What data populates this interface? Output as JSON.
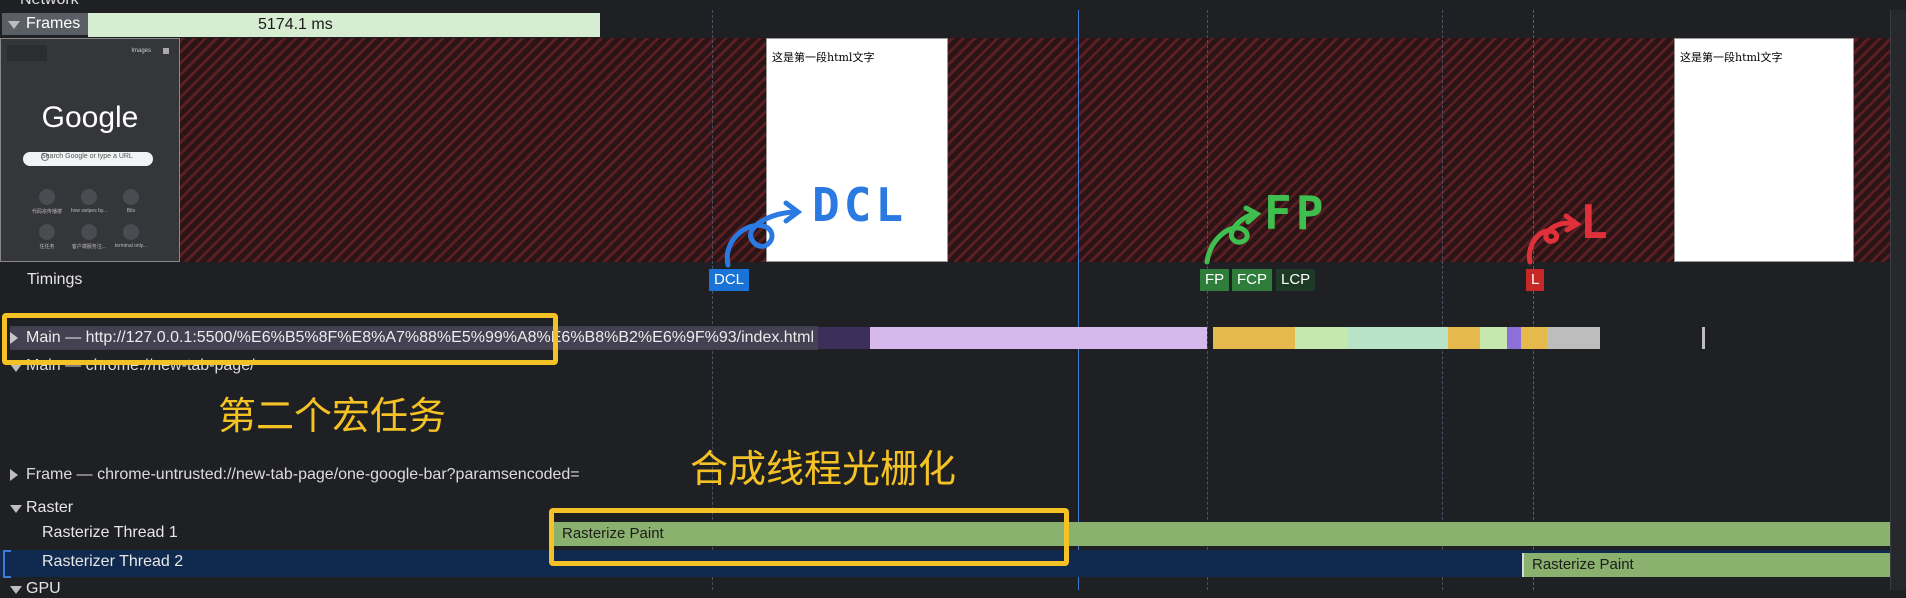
{
  "network": {
    "label": "Network"
  },
  "frames": {
    "label": "Frames",
    "duration": "5174.1 ms"
  },
  "thumbnails": {
    "google": {
      "logo": "Google",
      "search_placeholder": "Search Google or type a URL",
      "images_link": "Images",
      "shortcuts": [
        "代码宗传播楼",
        "how swipes by...",
        "Bits",
        "任任务",
        "客户端服务注...",
        "terminal only..."
      ]
    },
    "paint_text_1": "这是第一段html文字",
    "paint_text_2": "这是第一段html文字"
  },
  "timings": {
    "label": "Timings",
    "markers": {
      "dcl": "DCL",
      "fp": "FP",
      "fcp": "FCP",
      "lcp": "LCP",
      "l": "L"
    }
  },
  "tracks": {
    "main": "Main — http://127.0.0.1:5500/%E6%B5%8F%E8%A7%88%E5%99%A8%E6%B8%B2%E6%9F%93/index.html",
    "main_ntp": "Main — chrome://new-tab-page/",
    "frame_untrusted": "Frame — chrome-untrusted://new-tab-page/one-google-bar?paramsencoded=",
    "raster": "Raster",
    "rasterizer_1": "Rasterize Thread 1",
    "rasterizer_2": "Rasterizer Thread 2",
    "gpu": "GPU"
  },
  "tasks": {
    "raster_paint_1": "Rasterize Paint",
    "raster_paint_2": "Rasterize Paint"
  },
  "annotations": {
    "macro_task": "第二个宏任务",
    "compositor_raster": "合成线程光栅化",
    "hand_dcl": "DCL",
    "hand_fp": "FP",
    "hand_l": "L"
  },
  "colors": {
    "highlight": "#f4c224",
    "dcl": "#1a73d6",
    "fp": "#2e7d3a",
    "load": "#c62828",
    "raster_task": "#8ab16e",
    "layout_purple": "#d5b8ec",
    "scripting_yellow": "#e6b94d",
    "paint_green": "#c5e8b0"
  }
}
